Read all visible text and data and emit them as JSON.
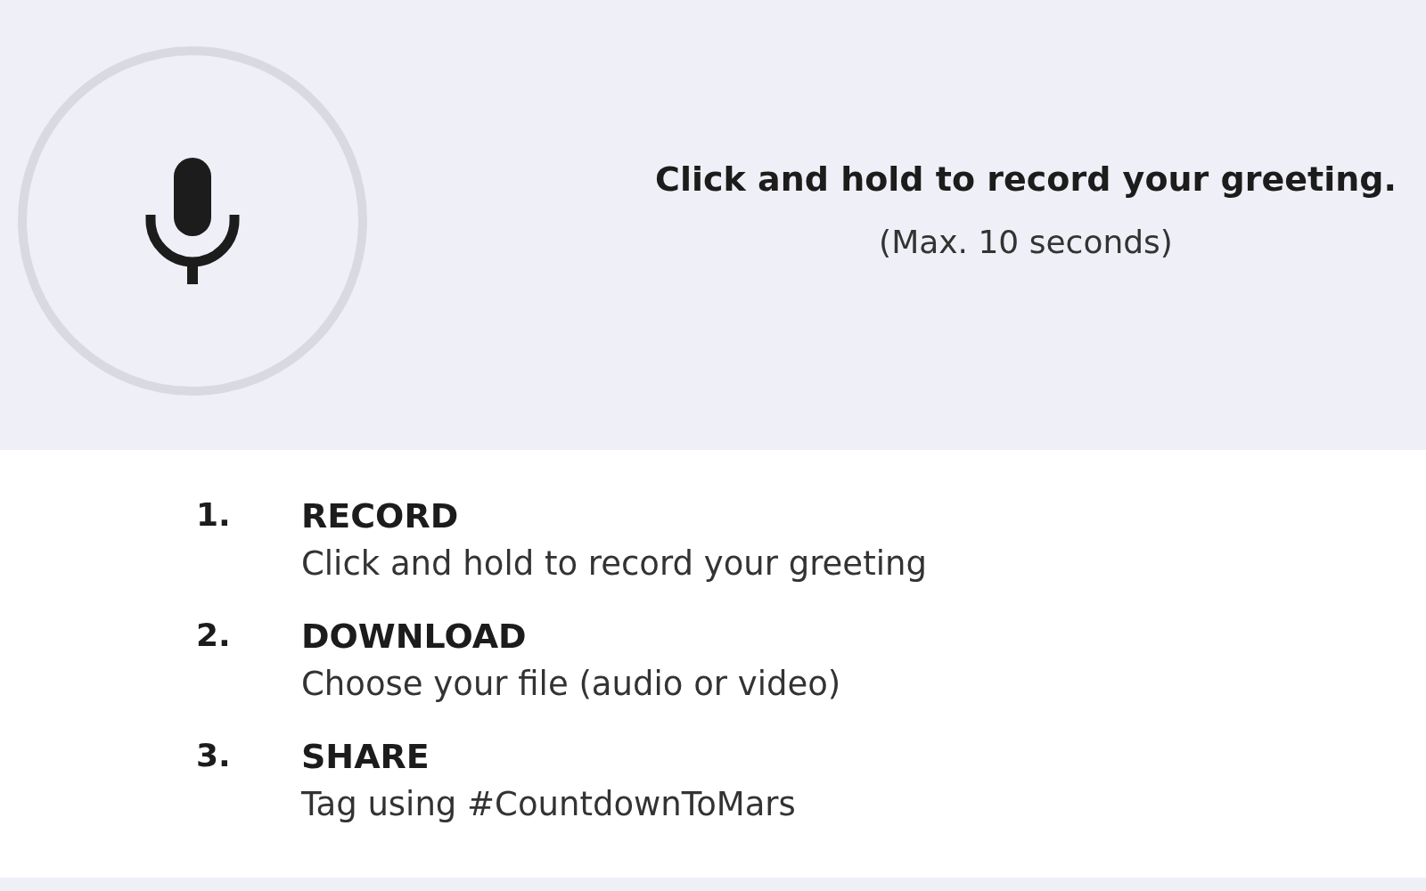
{
  "recorder": {
    "instruction": "Click and hold to record your greeting.",
    "limit": "(Max. 10 seconds)"
  },
  "steps": [
    {
      "number": "1.",
      "title": "RECORD",
      "text": "Click and hold to record your greeting"
    },
    {
      "number": "2.",
      "title": "DOWNLOAD",
      "text": "Choose your file (audio or video)"
    },
    {
      "number": "3.",
      "title": "SHARE",
      "text": "Tag using #CountdownToMars"
    }
  ]
}
